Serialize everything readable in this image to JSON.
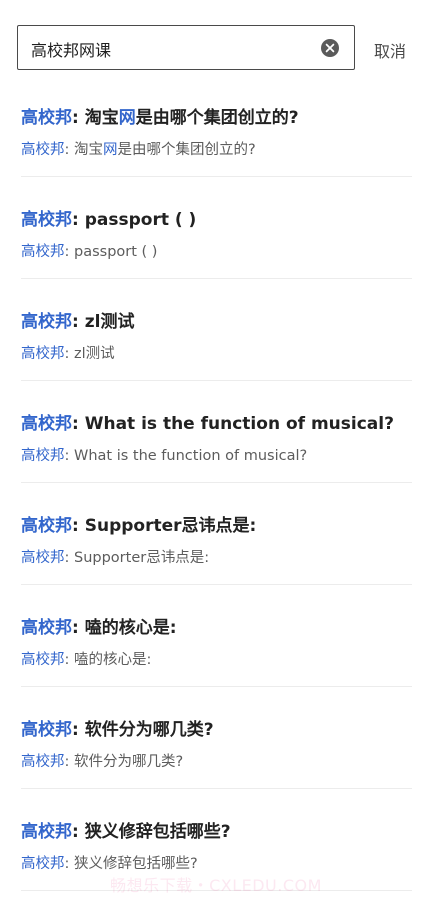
{
  "search": {
    "value": "高校邦网课",
    "cancel_label": "取消"
  },
  "colors": {
    "highlight": "#3366cc"
  },
  "results": [
    {
      "title": [
        {
          "t": "高校邦",
          "h": true
        },
        {
          "t": ": 淘宝",
          "h": false
        },
        {
          "t": "网",
          "h": true
        },
        {
          "t": "是由哪个集团创立的?",
          "h": false
        }
      ],
      "subtitle": [
        {
          "t": "高校邦",
          "h": true
        },
        {
          "t": ": 淘宝",
          "h": false
        },
        {
          "t": "网",
          "h": true
        },
        {
          "t": "是由哪个集团创立的?",
          "h": false
        }
      ]
    },
    {
      "title": [
        {
          "t": "高校邦",
          "h": true
        },
        {
          "t": ": passport ( )",
          "h": false
        }
      ],
      "subtitle": [
        {
          "t": "高校邦",
          "h": true
        },
        {
          "t": ": passport ( )",
          "h": false
        }
      ]
    },
    {
      "title": [
        {
          "t": "高校邦",
          "h": true
        },
        {
          "t": ": zl测试",
          "h": false
        }
      ],
      "subtitle": [
        {
          "t": "高校邦",
          "h": true
        },
        {
          "t": ": zl测试",
          "h": false
        }
      ]
    },
    {
      "title": [
        {
          "t": "高校邦",
          "h": true
        },
        {
          "t": ": What is the function of musical?",
          "h": false
        }
      ],
      "subtitle": [
        {
          "t": "高校邦",
          "h": true
        },
        {
          "t": ": What is the function of musical?",
          "h": false
        }
      ]
    },
    {
      "title": [
        {
          "t": "高校邦",
          "h": true
        },
        {
          "t": ": Supporter忌讳点是:",
          "h": false
        }
      ],
      "subtitle": [
        {
          "t": "高校邦",
          "h": true
        },
        {
          "t": ": Supporter忌讳点是:",
          "h": false
        }
      ]
    },
    {
      "title": [
        {
          "t": "高校邦",
          "h": true
        },
        {
          "t": ": 嗑的核心是:",
          "h": false
        }
      ],
      "subtitle": [
        {
          "t": "高校邦",
          "h": true
        },
        {
          "t": ": 嗑的核心是:",
          "h": false
        }
      ]
    },
    {
      "title": [
        {
          "t": "高校邦",
          "h": true
        },
        {
          "t": ": 软件分为哪几类?",
          "h": false
        }
      ],
      "subtitle": [
        {
          "t": "高校邦",
          "h": true
        },
        {
          "t": ": 软件分为哪几类?",
          "h": false
        }
      ]
    },
    {
      "title": [
        {
          "t": "高校邦",
          "h": true
        },
        {
          "t": ": 狭义修辞包括哪些?",
          "h": false
        }
      ],
      "subtitle": [
        {
          "t": "高校邦",
          "h": true
        },
        {
          "t": ": 狭义修辞包括哪些?",
          "h": false
        }
      ]
    }
  ],
  "watermark": "畅想乐下载・CXLEDU.COM"
}
